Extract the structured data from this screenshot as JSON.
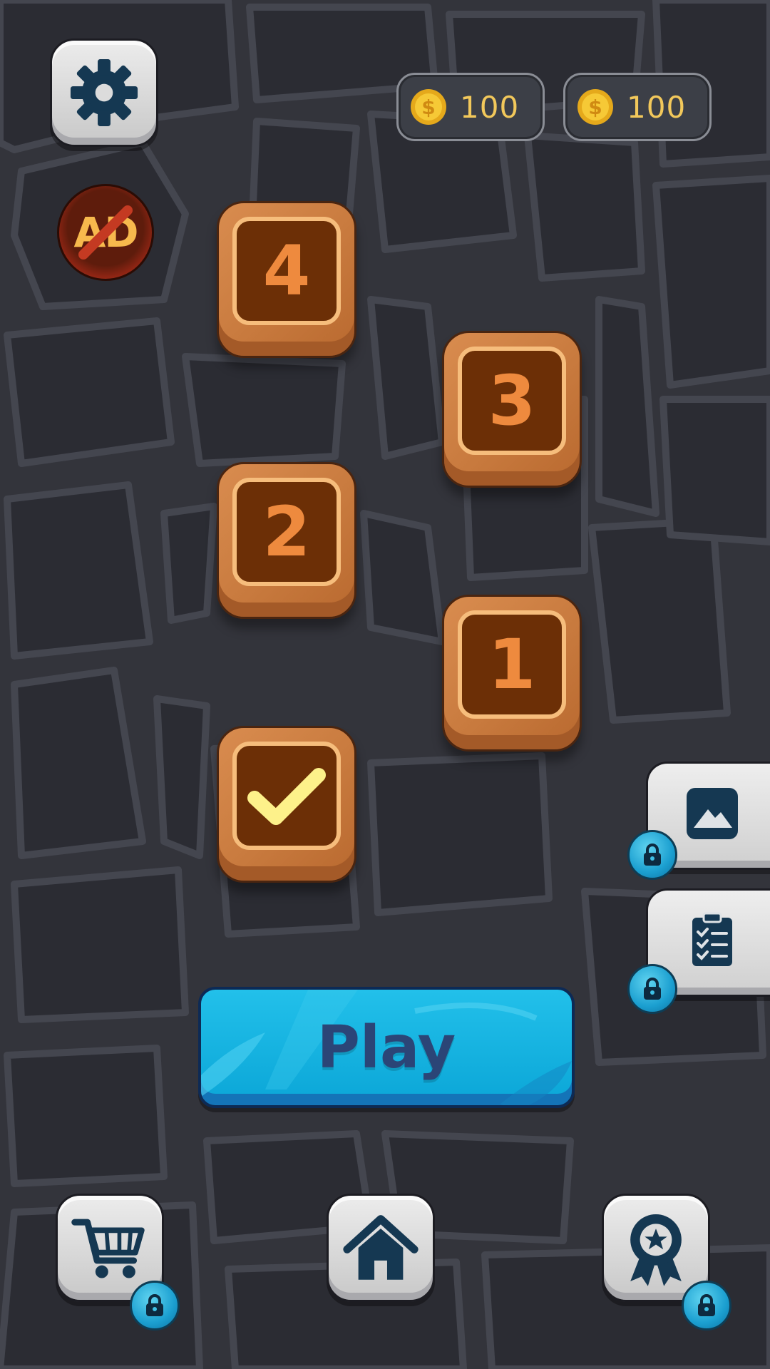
{
  "hud": {
    "coins": [
      {
        "icon": "dollar-coin-icon",
        "value": "100"
      },
      {
        "icon": "dollar-coin-icon",
        "value": "100"
      }
    ],
    "settings_icon": "gear-icon",
    "no_ads_label": "AD"
  },
  "levels": [
    {
      "label": "4",
      "state": "available"
    },
    {
      "label": "3",
      "state": "available"
    },
    {
      "label": "2",
      "state": "available"
    },
    {
      "label": "1",
      "state": "available"
    },
    {
      "label": "",
      "state": "completed",
      "icon": "checkmark-icon"
    }
  ],
  "side_panels": [
    {
      "icon": "picture-icon",
      "locked": true
    },
    {
      "icon": "checklist-icon",
      "locked": true
    }
  ],
  "play_button": {
    "label": "Play"
  },
  "bottom_nav": [
    {
      "icon": "shopping-cart-icon",
      "locked": true
    },
    {
      "icon": "home-icon",
      "locked": false
    },
    {
      "icon": "award-ribbon-icon",
      "locked": true
    }
  ],
  "colors": {
    "background": "#34353c",
    "tile_wood": "#c87a3e",
    "tile_inner": "#6c2f06",
    "tile_number": "#ee8a3e",
    "check": "#fdf18a",
    "play_blue": "#22c0ea",
    "play_text": "#2b4577",
    "coin_text": "#f2c85b",
    "icon_navy": "#153852"
  }
}
